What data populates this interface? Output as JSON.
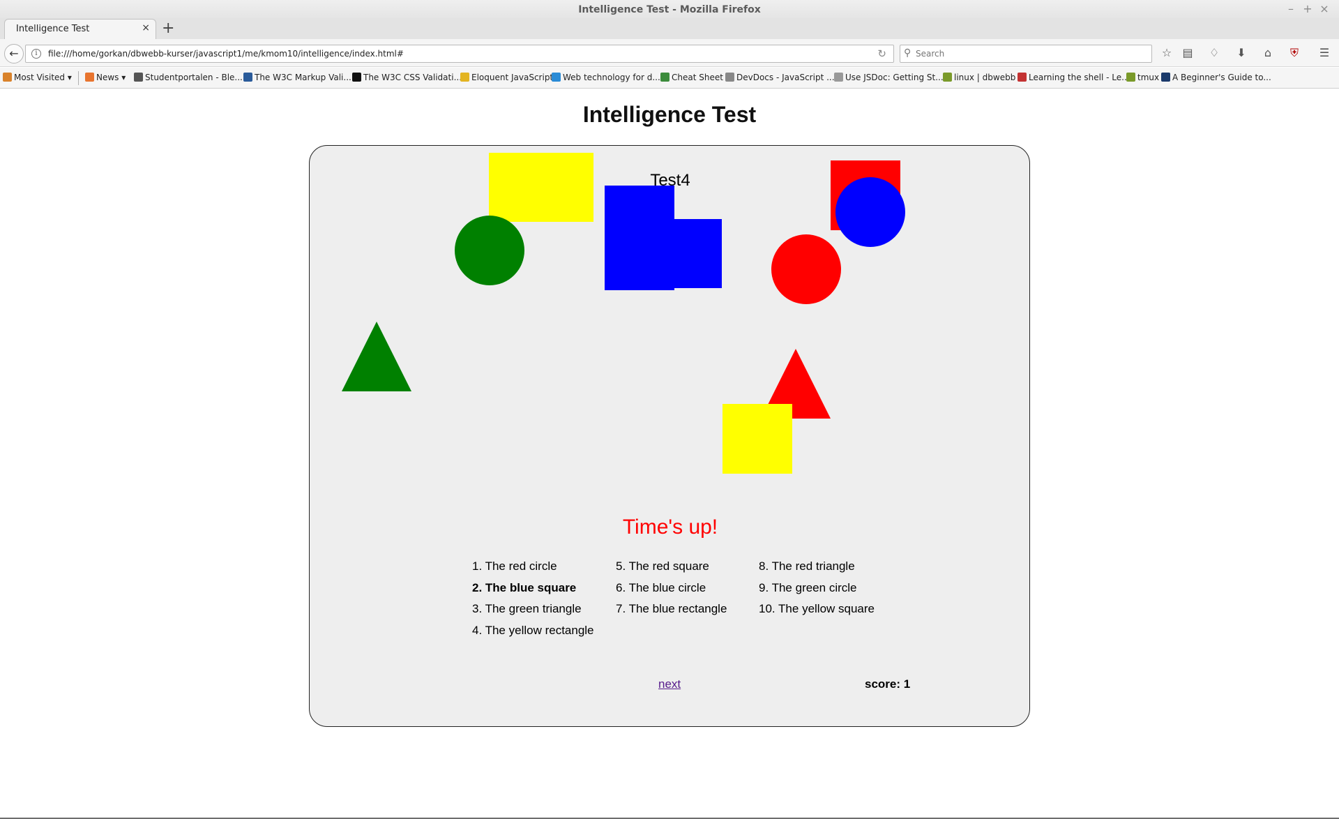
{
  "window": {
    "title": "Intelligence Test - Mozilla Firefox",
    "controls": [
      "–",
      "+",
      "×"
    ]
  },
  "tab": {
    "label": "Intelligence Test",
    "close": "×",
    "new_tab": "+"
  },
  "navbar": {
    "url": "file:///home/gorkan/dbwebb-kurser/javascript1/me/kmom10/intelligence/index.html#",
    "search_placeholder": "Search"
  },
  "icons": {
    "back": "back-arrow-icon",
    "info": "info-icon",
    "reload": "reload-icon",
    "search": "search-icon",
    "bookmark_star": "star-icon",
    "reader": "clipboard-icon",
    "pocket": "pocket-icon",
    "downloads": "download-icon",
    "home": "home-icon",
    "ublock": "shield-icon",
    "menu": "hamburger-icon"
  },
  "bookmarks": [
    {
      "label": "Most Visited ▾",
      "color": "#d9822b"
    },
    {
      "label": "News ▾",
      "color": "#e8752f"
    },
    {
      "label": "Studentportalen - Ble...",
      "color": "#555555"
    },
    {
      "label": "The W3C Markup Vali...",
      "color": "#2a5b9a"
    },
    {
      "label": "The W3C CSS Validati...",
      "color": "#111111"
    },
    {
      "label": "Eloquent JavaScript",
      "color": "#e3b422"
    },
    {
      "label": "Web technology for d...",
      "color": "#2a8bd6"
    },
    {
      "label": "Cheat Sheet",
      "color": "#3c8c3c"
    },
    {
      "label": "DevDocs - JavaScript ...",
      "color": "#888888"
    },
    {
      "label": "Use JSDoc: Getting St...",
      "color": "#999999"
    },
    {
      "label": "linux | dbwebb",
      "color": "#7a9a2a"
    },
    {
      "label": "Learning the shell - Le...",
      "color": "#c33333"
    },
    {
      "label": "tmux",
      "color": "#7a9a2a"
    },
    {
      "label": "A Beginner's Guide to...",
      "color": "#1b3a6b"
    }
  ],
  "page": {
    "title": "Intelligence Test",
    "test_label": "Test4",
    "status": "Time's up!",
    "next_label": "next",
    "score_label": "score:",
    "score_value": "1"
  },
  "shapes": [
    {
      "name": "yellow-rectangle-shape",
      "kind": "rect",
      "color": "#ffff00"
    },
    {
      "name": "blue-square-shape",
      "kind": "rect",
      "color": "#0000ff"
    },
    {
      "name": "blue-rectangle-shape",
      "kind": "rect",
      "color": "#0000ff"
    },
    {
      "name": "green-circle-shape",
      "kind": "circle",
      "color": "#008000"
    },
    {
      "name": "red-square-shape",
      "kind": "rect",
      "color": "#ff0000"
    },
    {
      "name": "blue-circle-shape",
      "kind": "circle",
      "color": "#0000ff"
    },
    {
      "name": "red-circle-shape",
      "kind": "circle",
      "color": "#ff0000"
    },
    {
      "name": "green-triangle-shape",
      "kind": "triangle",
      "color": "#008000"
    },
    {
      "name": "red-triangle-shape",
      "kind": "triangle",
      "color": "#ff0000"
    },
    {
      "name": "yellow-square-shape",
      "kind": "rect",
      "color": "#ffff00"
    }
  ],
  "choices": {
    "col1": [
      "1. The red circle",
      "2. The blue square",
      "3. The green triangle",
      "4. The yellow rectangle"
    ],
    "col2": [
      "5. The red square",
      "6. The blue circle",
      "7. The blue rectangle"
    ],
    "col3": [
      "8. The red triangle",
      "9. The green circle",
      "10. The yellow square"
    ],
    "selected": "2. The blue square"
  }
}
